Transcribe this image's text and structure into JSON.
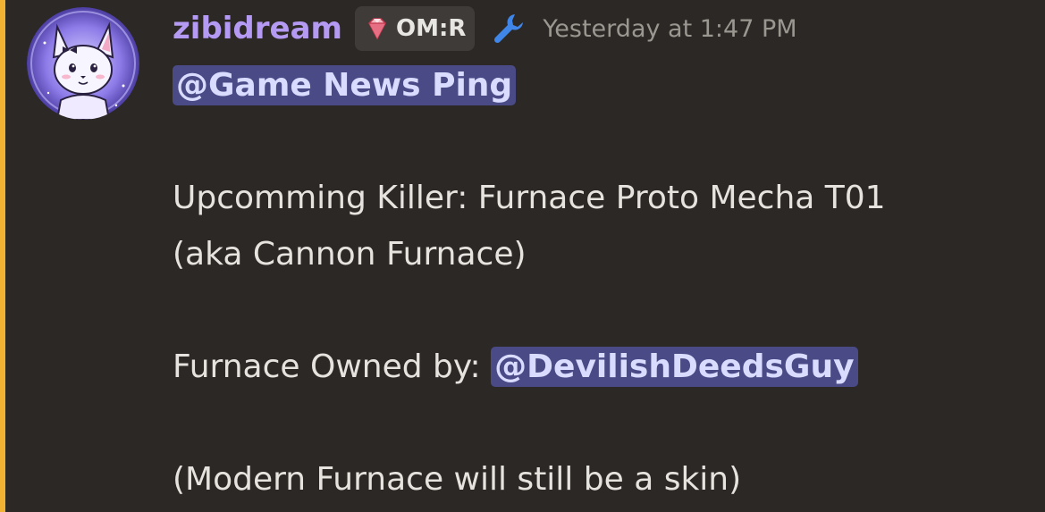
{
  "message": {
    "author": "zibidream",
    "role_tag": "OM:R",
    "timestamp": "Yesterday at 1:47 PM",
    "mention_top": "@Game News Ping",
    "line1": "Upcomming Killer: Furnace Proto Mecha T01",
    "line2": "(aka Cannon Furnace)",
    "owned_prefix": "Furnace Owned by: ",
    "owner_mention": "@DevilishDeedsGuy",
    "line4": "(Modern Furnace will still be a skin)"
  },
  "colors": {
    "background": "#2c2825",
    "highlight": "#f0b232",
    "username": "#b49af2",
    "mention_bg": "#4a4a86",
    "timestamp": "#9a9690",
    "wrench": "#3f86e8"
  },
  "icons": {
    "avatar": "fox-avatar",
    "role": "gem-icon",
    "badge": "wrench-icon"
  }
}
